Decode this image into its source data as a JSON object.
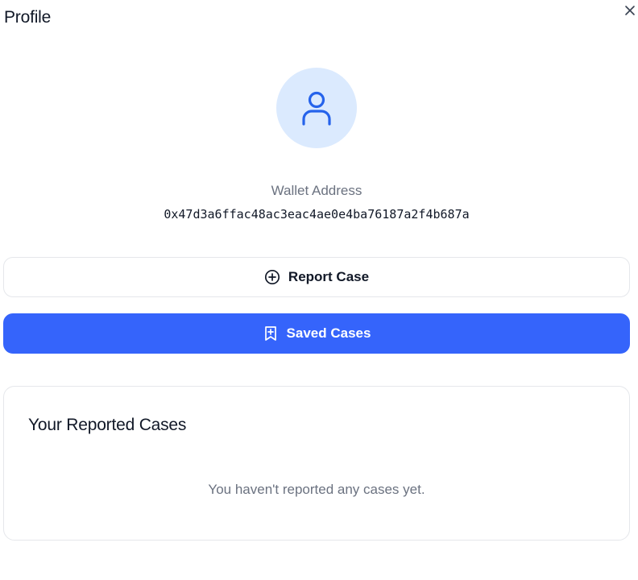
{
  "header": {
    "title": "Profile",
    "close_icon": "close-icon"
  },
  "profile": {
    "avatar_icon": "user-icon",
    "wallet_label": "Wallet Address",
    "wallet_address": "0x47d3a6ffac48ac3eac4ae0e4ba76187a2f4b687a"
  },
  "actions": {
    "report_case_label": "Report Case",
    "report_case_icon": "plus-circle-icon",
    "saved_cases_label": "Saved Cases",
    "saved_cases_icon": "bookmark-plus-icon"
  },
  "reported_cases": {
    "title": "Your Reported Cases",
    "empty_message": "You haven't reported any cases yet."
  },
  "colors": {
    "accent": "#3564fb",
    "avatar_bg": "#dbeafe",
    "avatar_icon": "#2563eb",
    "muted_text": "#6b7280",
    "border": "#e5e7eb"
  }
}
